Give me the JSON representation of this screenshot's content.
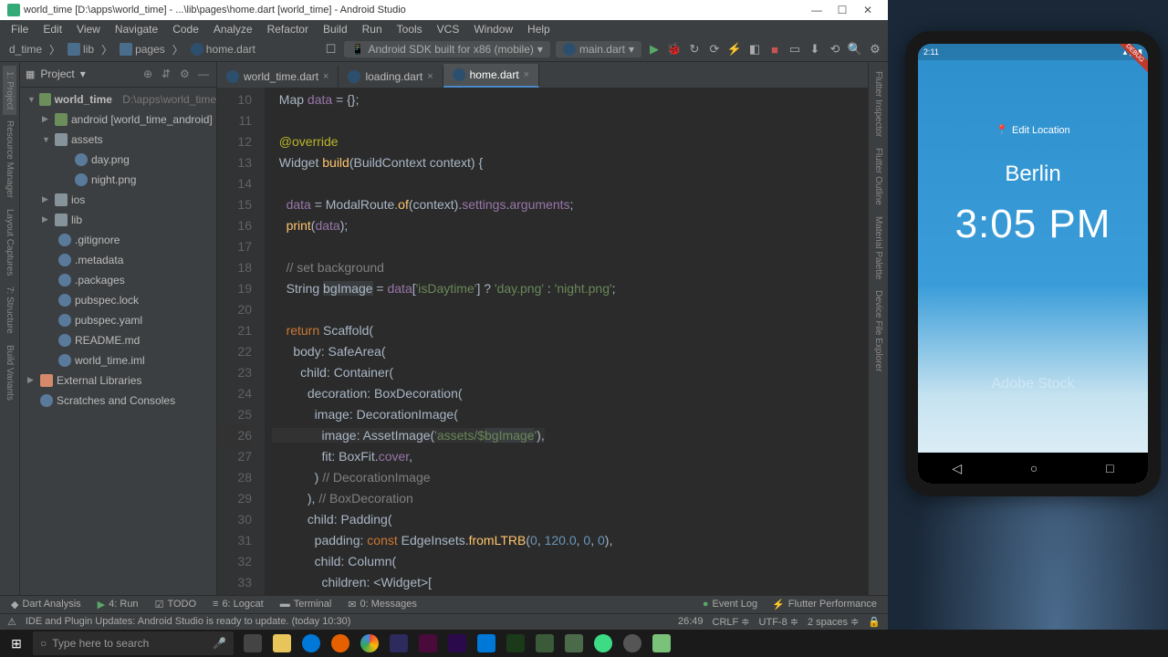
{
  "titlebar": "world_time [D:\\apps\\world_time] - ...\\lib\\pages\\home.dart [world_time] - Android Studio",
  "menus": [
    "File",
    "Edit",
    "View",
    "Navigate",
    "Code",
    "Analyze",
    "Refactor",
    "Build",
    "Run",
    "Tools",
    "VCS",
    "Window",
    "Help"
  ],
  "breadcrumbs": [
    "d_time",
    "lib",
    "pages",
    "home.dart"
  ],
  "device_dropdown": "Android SDK built for x86 (mobile)",
  "run_config": "main.dart",
  "project_label": "Project",
  "tree": {
    "root": "world_time",
    "root_path": "D:\\apps\\world_time",
    "android": "android [world_time_android]",
    "assets": "assets",
    "day_png": "day.png",
    "night_png": "night.png",
    "ios": "ios",
    "lib": "lib",
    "gitignore": ".gitignore",
    "metadata": ".metadata",
    "packages": ".packages",
    "pubspec_lock": "pubspec.lock",
    "pubspec_yaml": "pubspec.yaml",
    "readme": "README.md",
    "iml": "world_time.iml",
    "ext_lib": "External Libraries",
    "scratches": "Scratches and Consoles"
  },
  "tabs": [
    {
      "label": "world_time.dart",
      "active": false
    },
    {
      "label": "loading.dart",
      "active": false
    },
    {
      "label": "home.dart",
      "active": true
    }
  ],
  "line_numbers": [
    10,
    11,
    12,
    13,
    14,
    15,
    16,
    17,
    18,
    19,
    20,
    21,
    22,
    23,
    24,
    25,
    26,
    27,
    28,
    29,
    30,
    31,
    32,
    33
  ],
  "bottom_tabs": {
    "dart": "Dart Analysis",
    "run": "4: Run",
    "todo": "TODO",
    "logcat": "6: Logcat",
    "terminal": "Terminal",
    "messages": "0: Messages",
    "event_log": "Event Log",
    "flutter_perf": "Flutter Performance"
  },
  "status": {
    "message": "IDE and Plugin Updates: Android Studio is ready to update. (today 10:30)",
    "position": "26:49",
    "line_ending": "CRLF",
    "encoding": "UTF-8",
    "indent": "2 spaces"
  },
  "search_placeholder": "Type here to search",
  "emulator": {
    "status_time": "2:11",
    "edit_location": "Edit Location",
    "city": "Berlin",
    "time": "3:05 PM",
    "watermark": "Adobe Stock"
  },
  "side_tabs": {
    "left_top": "1: Project",
    "left_mid1": "Resource Manager",
    "left_mid2": "Layout Captures",
    "left_bot1": "7: Structure",
    "left_bot2": "Build Variants",
    "right1": "Flutter Inspector",
    "right2": "Flutter Outline",
    "right3": "Material Palette",
    "right4": "Device File Explorer"
  }
}
